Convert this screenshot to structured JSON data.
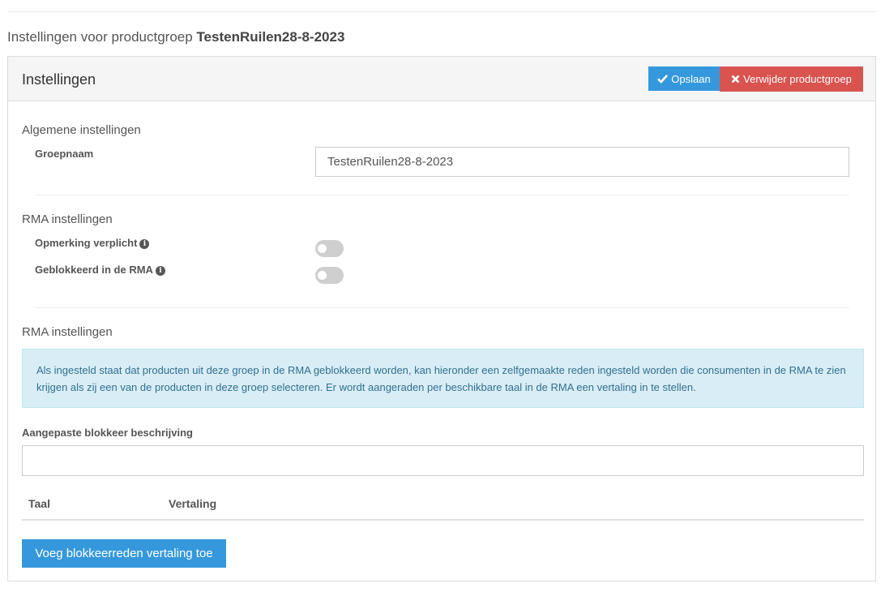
{
  "page": {
    "title_prefix": "Instellingen voor productgroep",
    "title_group": "TestenRuilen28-8-2023"
  },
  "panel": {
    "title": "Instellingen",
    "save_label": "Opslaan",
    "delete_label": "Verwijder productgroep"
  },
  "general": {
    "section_title": "Algemene instellingen",
    "groupname_label": "Groepnaam",
    "groupname_value": "TestenRuilen28-8-2023"
  },
  "rma": {
    "section_title": "RMA instellingen",
    "remark_required_label": "Opmerking verplicht",
    "remark_required_on": false,
    "blocked_label": "Geblokkeerd in de RMA",
    "blocked_on": false
  },
  "rma_block": {
    "section_title": "RMA instellingen",
    "info_text": "Als ingesteld staat dat producten uit deze groep in de RMA geblokkeerd worden, kan hieronder een zelfgemaakte reden ingesteld worden die consumenten in de RMA te zien krijgen als zij een van de producten in deze groep selecteren. Er wordt aangeraden per beschikbare taal in de RMA een vertaling in te stellen.",
    "description_label": "Aangepaste blokkeer beschrijving",
    "description_value": "",
    "table_headers": [
      "Taal",
      "Vertaling"
    ],
    "add_button_label": "Voeg blokkeerreden vertaling toe"
  },
  "colors": {
    "primary": "#3598dc",
    "danger": "#d9534f",
    "info_bg": "#d9edf7",
    "info_text": "#31708f"
  }
}
